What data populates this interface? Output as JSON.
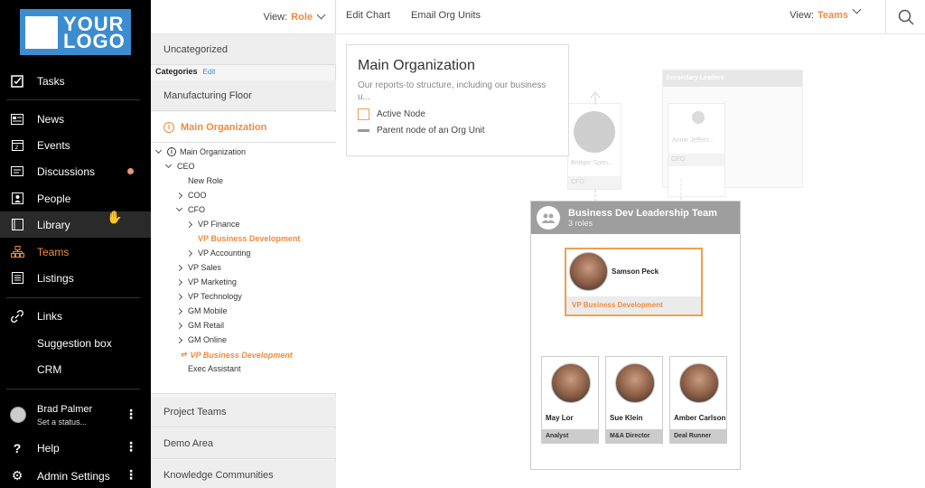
{
  "sidebar": {
    "logo": "YOUR LOGO",
    "items": [
      {
        "label": "Tasks"
      },
      {
        "label": "News"
      },
      {
        "label": "Events"
      },
      {
        "label": "Discussions"
      },
      {
        "label": "People"
      },
      {
        "label": "Library"
      },
      {
        "label": "Teams"
      },
      {
        "label": "Listings"
      },
      {
        "label": "Links"
      },
      {
        "label": "Suggestion box"
      },
      {
        "label": "CRM"
      }
    ],
    "user": {
      "name": "Brad Palmer",
      "status": "Set a status..."
    },
    "help": "Help",
    "admin": "Admin Settings"
  },
  "mid": {
    "view_label": "View:",
    "view_value": "Role",
    "uncategorized": "Uncategorized",
    "categories_label": "Categories",
    "categories_edit": "Edit",
    "manufacturing": "Manufacturing Floor",
    "main_org": "Main Organization",
    "tree": [
      "Main Organization",
      "CEO",
      "New Role",
      "COO",
      "CFO",
      "VP Finance",
      "VP Business Development",
      "VP Accounting",
      "VP Sales",
      "VP Marketing",
      "VP Technology",
      "GM Mobile",
      "GM Retail",
      "GM Online",
      "VP Business Development",
      "Exec Assistant"
    ],
    "project_teams": "Project Teams",
    "demo_area": "Demo Area",
    "knowledge": "Knowledge Communities"
  },
  "topbar": {
    "edit_chart": "Edit Chart",
    "email_org_units": "Email Org Units",
    "view_label": "View:",
    "view_value": "Teams"
  },
  "legend": {
    "title": "Main Organization",
    "desc": "Our reports-to structure, including our business u...",
    "active_node": "Active Node",
    "parent_node": "Parent node of an Org Unit"
  },
  "ghost": {
    "secondary_leaders": "Secondary Leaders",
    "annie": "Annie Jeffers...",
    "bridger": "Bridger Spen...",
    "cfo": "CFO",
    "ceo": "CEO"
  },
  "team": {
    "title": "Business Dev Leadership Team",
    "subtitle": "3 roles",
    "lead": {
      "name": "Samson Peck",
      "role": "VP Business Development"
    },
    "members": [
      {
        "name": "May Lor",
        "role": "Analyst"
      },
      {
        "name": "Sue Klein",
        "role": "M&A Director"
      },
      {
        "name": "Amber Carlson",
        "role": "Deal Runner"
      }
    ]
  },
  "colors": {
    "accent": "#f08a3c",
    "link": "#3a8fd6",
    "sidebar": "#000000"
  }
}
